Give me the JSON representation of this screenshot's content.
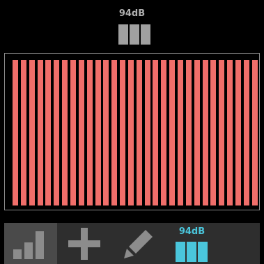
{
  "header": {
    "level_label": "94dB",
    "level_bars": 3
  },
  "display": {
    "bar_count": 30,
    "bar_color": "#f06e6a",
    "bar_level": 1.0
  },
  "toolbar": {
    "items": [
      {
        "name": "stats",
        "icon": "bar-chart-icon",
        "selected": true
      },
      {
        "name": "add",
        "icon": "plus-icon",
        "selected": false
      },
      {
        "name": "edit",
        "icon": "pencil-icon",
        "selected": false
      },
      {
        "name": "level",
        "icon": "level-meter-icon",
        "label": "94dB",
        "selected": false
      }
    ]
  },
  "colors": {
    "background": "#000000",
    "toolbar": "#2e2e2e",
    "toolbar_selected": "#4a4a4a",
    "icon_gray": "#8c8c8c",
    "accent": "#4ac6dc"
  }
}
